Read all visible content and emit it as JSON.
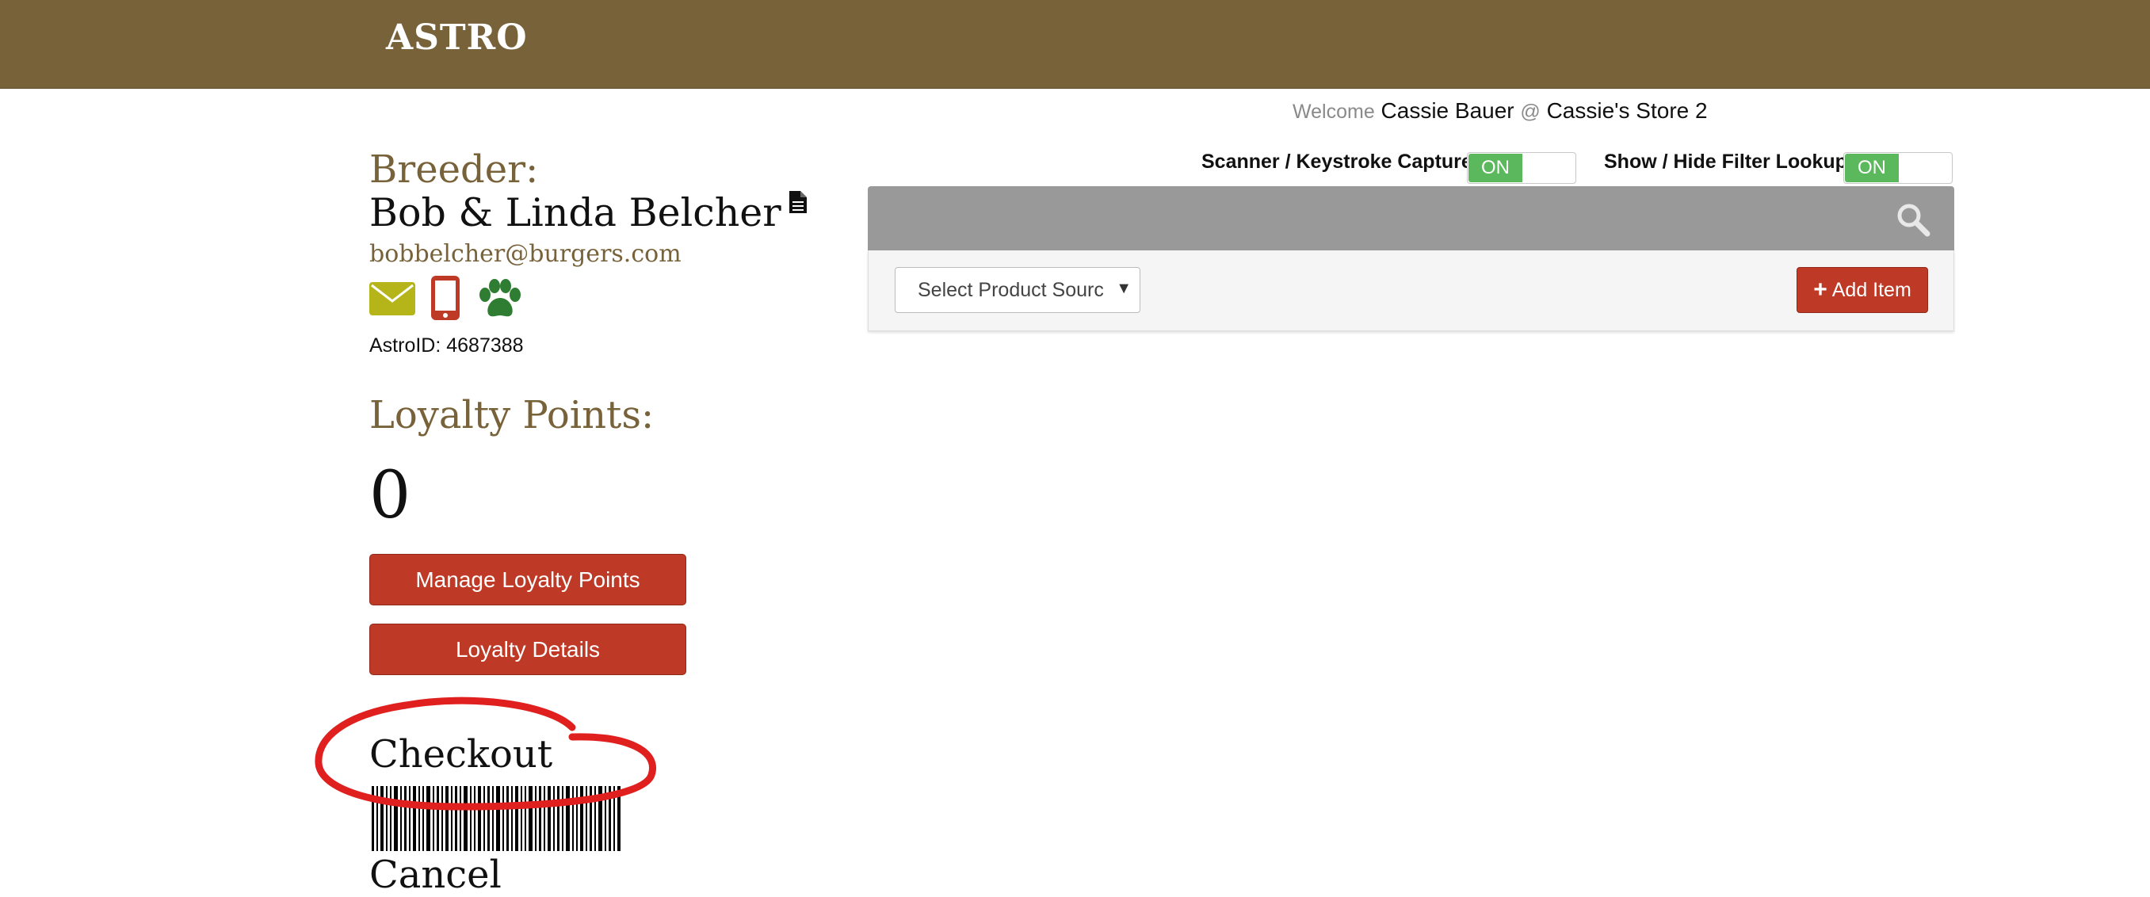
{
  "header": {
    "logo_text": "ASTRO",
    "background_color": "#77623a"
  },
  "welcome": {
    "prefix": "Welcome",
    "user": "Cassie Bauer",
    "at": "@",
    "store": "Cassie's Store 2"
  },
  "customer": {
    "breeder_label": "Breeder:",
    "name": "Bob & Linda Belcher",
    "email": "bobbelcher@burgers.com",
    "astro_id": "AstroID: 4687388",
    "icons": [
      "document-icon",
      "envelope-icon",
      "mobile-phone-icon",
      "paw-icon"
    ]
  },
  "loyalty": {
    "label": "Loyalty Points:",
    "points": "0",
    "manage_button": "Manage Loyalty Points",
    "details_button": "Loyalty Details"
  },
  "checkout": {
    "checkout_label": "Checkout",
    "cancel_label": "Cancel",
    "annotation_color": "#e0201e"
  },
  "toggles": {
    "scanner_label": "Scanner / Keystroke Capture",
    "scanner_state": "ON",
    "filter_label": "Show / Hide Filter Lookup",
    "filter_state": "ON",
    "on_color": "#5cb85c"
  },
  "product": {
    "source_select_value": "Select Product Sourc",
    "add_item_button": "Add Item",
    "button_color": "#bf3a26"
  }
}
